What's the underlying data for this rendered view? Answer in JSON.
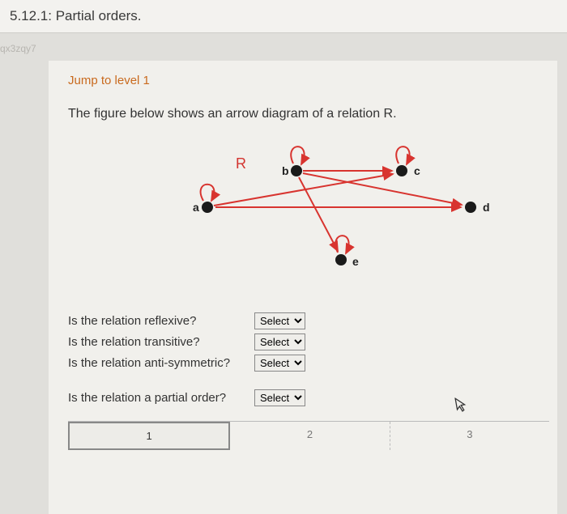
{
  "title": "5.12.1: Partial orders.",
  "watermark": "qx3zqy7",
  "jump_link": "Jump to level 1",
  "figure_caption": "The figure below shows an arrow diagram of a relation R.",
  "diagram": {
    "relation_label": "R",
    "nodes": [
      "a",
      "b",
      "c",
      "d",
      "e"
    ],
    "edges_description": "Self-loops on a, b, c, e. Edges: a→c, a→d, b→c, b→d, b→e"
  },
  "questions": [
    {
      "label": "Is the relation reflexive?",
      "select": "Select"
    },
    {
      "label": "Is the relation transitive?",
      "select": "Select"
    },
    {
      "label": "Is the relation anti-symmetric?",
      "select": "Select"
    },
    {
      "label": "Is the relation a partial order?",
      "select": "Select"
    }
  ],
  "progress": {
    "steps": [
      "1",
      "2",
      "3"
    ],
    "active": 0
  }
}
